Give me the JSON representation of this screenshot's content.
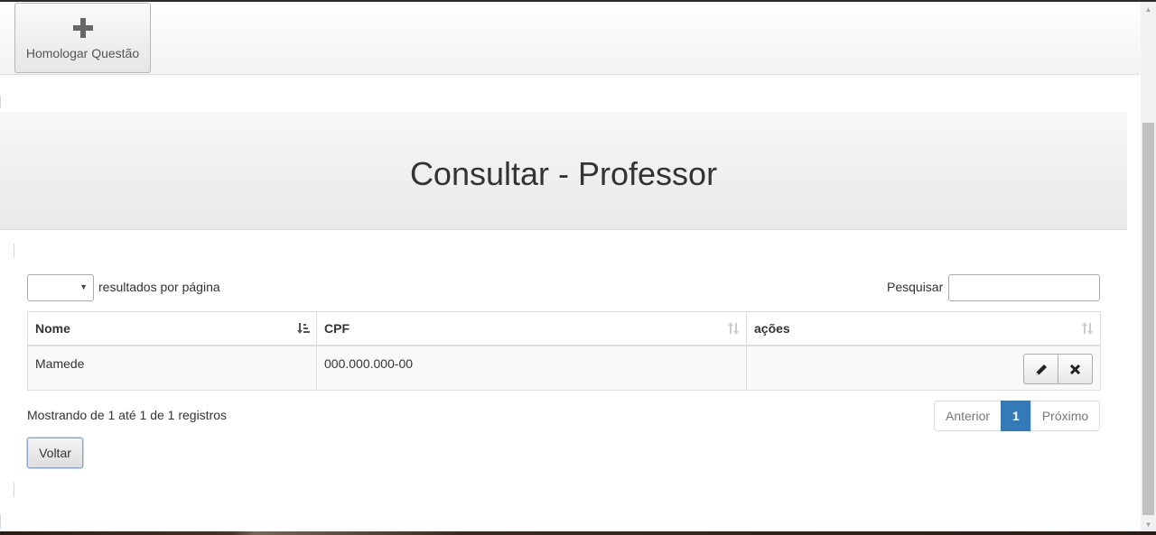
{
  "toolbar": {
    "homologar_label": "Homologar Questão",
    "homologar_icon": "plus-icon"
  },
  "page": {
    "title": "Consultar - Professor"
  },
  "table_controls": {
    "length_value": "",
    "length_suffix": "resultados por página",
    "search_label": "Pesquisar",
    "search_value": ""
  },
  "table": {
    "columns": [
      "Nome",
      "CPF",
      "ações"
    ],
    "rows": [
      {
        "nome": "Mamede",
        "cpf": "000.000.000-00",
        "actions": [
          "edit-icon",
          "delete-icon"
        ]
      }
    ]
  },
  "footer": {
    "info": "Mostrando de 1 até 1 de 1 registros",
    "pagination": {
      "previous": "Anterior",
      "current": "1",
      "next": "Próximo"
    },
    "back_label": "Voltar"
  },
  "colors": {
    "accent": "#337ab7"
  }
}
